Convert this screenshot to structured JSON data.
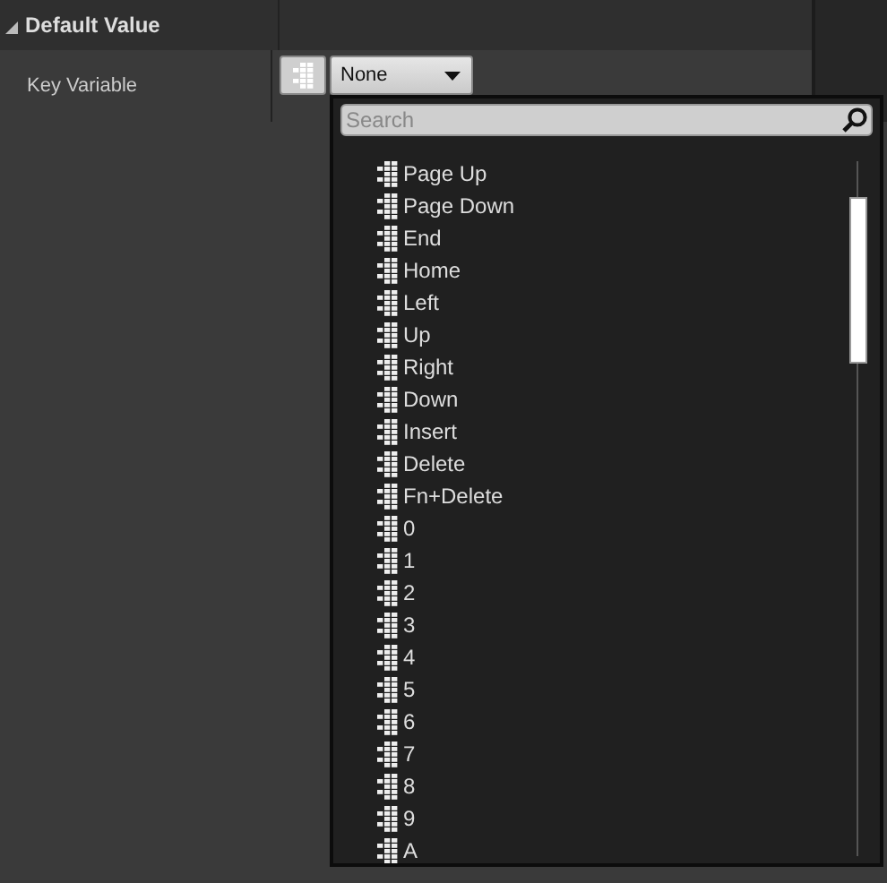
{
  "section": {
    "title": "Default Value",
    "expanded": true
  },
  "property": {
    "label": "Key Variable",
    "value": "None"
  },
  "dropdown": {
    "search": {
      "placeholder": "Search"
    },
    "items": [
      {
        "label": "Page Up"
      },
      {
        "label": "Page Down"
      },
      {
        "label": "End"
      },
      {
        "label": "Home"
      },
      {
        "label": "Left"
      },
      {
        "label": "Up"
      },
      {
        "label": "Right"
      },
      {
        "label": "Down"
      },
      {
        "label": "Insert"
      },
      {
        "label": "Delete"
      },
      {
        "label": "Fn+Delete"
      },
      {
        "label": "0"
      },
      {
        "label": "1"
      },
      {
        "label": "2"
      },
      {
        "label": "3"
      },
      {
        "label": "4"
      },
      {
        "label": "5"
      },
      {
        "label": "6"
      },
      {
        "label": "7"
      },
      {
        "label": "8"
      },
      {
        "label": "9"
      },
      {
        "label": "A"
      }
    ]
  }
}
